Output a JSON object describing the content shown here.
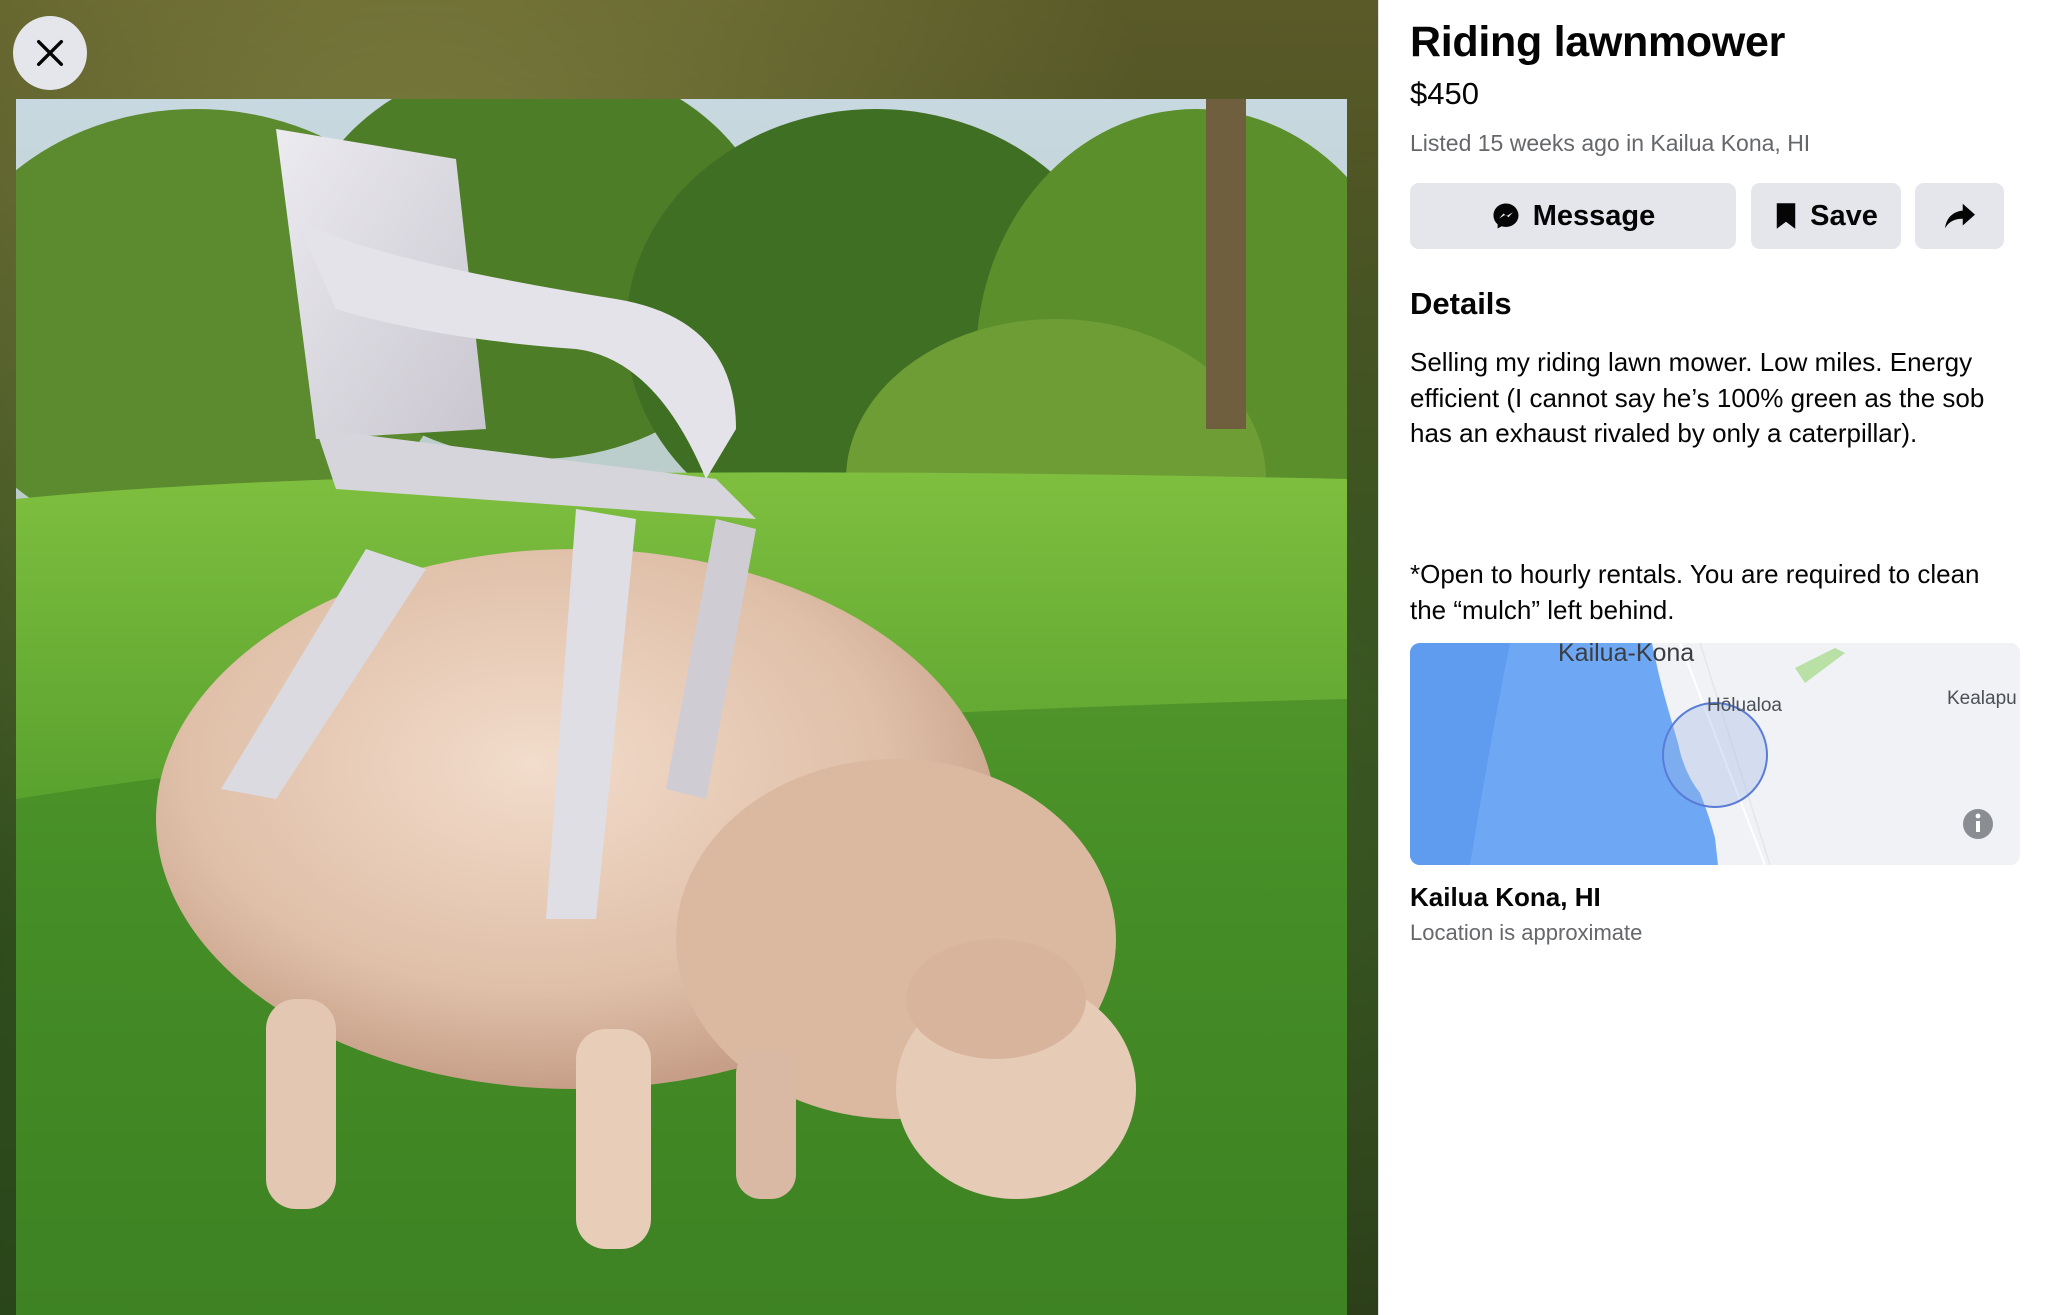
{
  "listing": {
    "title": "Riding lawnmower",
    "price": "$450",
    "listed_text": "Listed 15 weeks ago in Kailua Kona, HI"
  },
  "actions": {
    "message_label": "Message",
    "save_label": "Save"
  },
  "details": {
    "heading": "Details",
    "description": "Selling my riding lawn mower. Low miles. Energy efficient (I cannot say he’s 100% green as the sob has an exhaust rivaled by only a caterpillar).",
    "note": "*Open to hourly rentals. You are required to clean the “mulch” left behind."
  },
  "map": {
    "labels": {
      "city": "Kailua-Kona",
      "town1": "Hōlualoa",
      "town2": "Kealapu"
    }
  },
  "location": {
    "name": "Kailua Kona, HI",
    "note": "Location is approximate"
  },
  "icons": [
    "close-icon",
    "messenger-icon",
    "bookmark-icon",
    "share-icon",
    "info-icon"
  ],
  "colors": {
    "button_bg": "#e4e6eb",
    "text_primary": "#050505",
    "text_secondary": "#65676b",
    "map_water": "#6ea8f5"
  }
}
